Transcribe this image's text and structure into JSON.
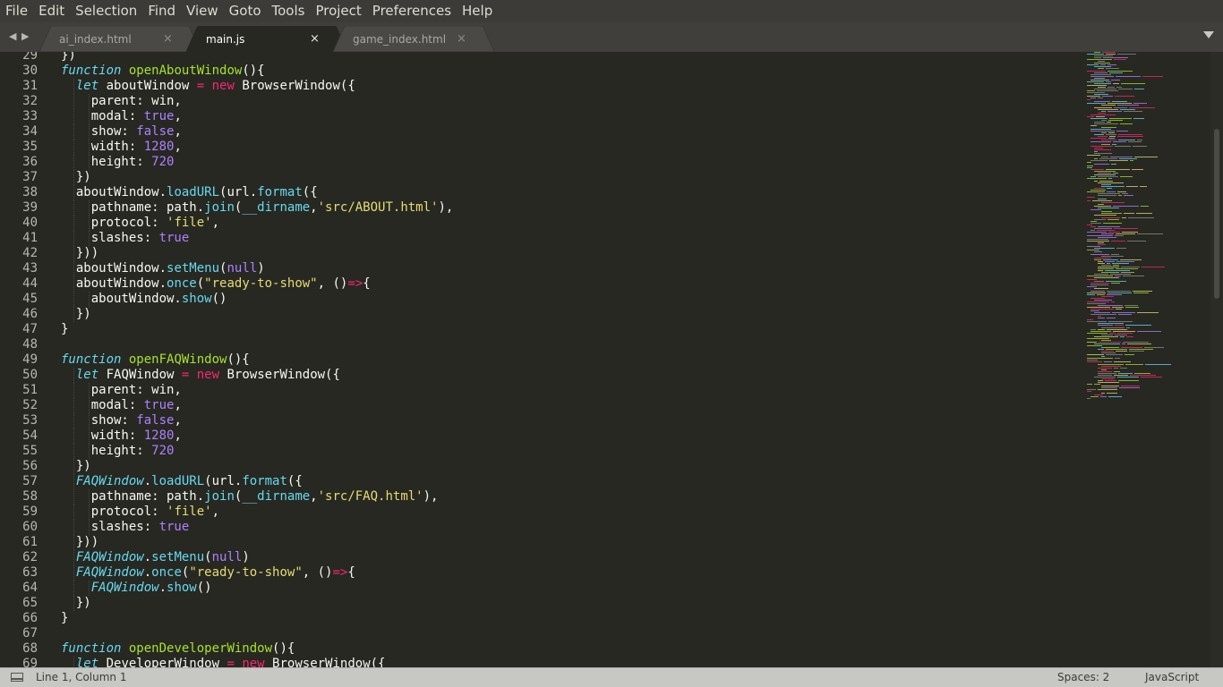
{
  "menu": [
    "File",
    "Edit",
    "Selection",
    "Find",
    "View",
    "Goto",
    "Tools",
    "Project",
    "Preferences",
    "Help"
  ],
  "tabs": [
    {
      "label": "ai_index.html",
      "active": false
    },
    {
      "label": "main.js",
      "active": true
    },
    {
      "label": "game_index.html",
      "active": false
    }
  ],
  "tab_close_glyph": "×",
  "nav": {
    "back_glyph": "◀",
    "forward_glyph": "▶"
  },
  "icons": [
    "back-arrow-icon",
    "forward-arrow-icon",
    "tab-close-icon",
    "tab-dropdown-icon",
    "panel-toggle-icon"
  ],
  "colors": {
    "background": "#272822",
    "keyword": "#f92672",
    "function_name": "#a6e22e",
    "builtin": "#66d9ef",
    "number": "#ae81ff",
    "string": "#e6db74",
    "text": "#f8f8f2",
    "gutter_text": "#b7b7af"
  },
  "editor": {
    "lines": [
      {
        "n": "29",
        "indent": 1,
        "tokens": [
          [
            "})",
            ""
          ]
        ]
      },
      {
        "n": "30",
        "indent": 1,
        "tokens": [
          [
            "function",
            "fi"
          ],
          [
            " ",
            ""
          ],
          [
            "openAboutWindow",
            "fn"
          ],
          [
            "(){",
            ""
          ]
        ]
      },
      {
        "n": "31",
        "indent": 2,
        "tokens": [
          [
            "let",
            "fi"
          ],
          [
            " aboutWindow ",
            ""
          ],
          [
            "=",
            "k"
          ],
          [
            " ",
            ""
          ],
          [
            "new",
            "k"
          ],
          [
            " BrowserWindow({",
            ""
          ]
        ]
      },
      {
        "n": "32",
        "indent": 3,
        "tokens": [
          [
            "parent: win,",
            ""
          ]
        ]
      },
      {
        "n": "33",
        "indent": 3,
        "tokens": [
          [
            "modal: ",
            ""
          ],
          [
            "true",
            "n"
          ],
          [
            ",",
            ""
          ]
        ]
      },
      {
        "n": "34",
        "indent": 3,
        "tokens": [
          [
            "show: ",
            ""
          ],
          [
            "false",
            "n"
          ],
          [
            ",",
            ""
          ]
        ]
      },
      {
        "n": "35",
        "indent": 3,
        "tokens": [
          [
            "width: ",
            ""
          ],
          [
            "1280",
            "n"
          ],
          [
            ",",
            ""
          ]
        ]
      },
      {
        "n": "36",
        "indent": 3,
        "tokens": [
          [
            "height: ",
            ""
          ],
          [
            "720",
            "n"
          ]
        ]
      },
      {
        "n": "37",
        "indent": 2,
        "tokens": [
          [
            "})",
            ""
          ]
        ]
      },
      {
        "n": "38",
        "indent": 2,
        "tokens": [
          [
            "aboutWindow.",
            ""
          ],
          [
            "loadURL",
            "m"
          ],
          [
            "(url.",
            ""
          ],
          [
            "format",
            "m"
          ],
          [
            "({",
            ""
          ]
        ]
      },
      {
        "n": "39",
        "indent": 3,
        "tokens": [
          [
            "pathname: path.",
            ""
          ],
          [
            "join",
            "m"
          ],
          [
            "(",
            ""
          ],
          [
            "__dirname",
            "m"
          ],
          [
            ",",
            ""
          ],
          [
            "'src/ABOUT.html'",
            "s"
          ],
          [
            "),",
            ""
          ]
        ]
      },
      {
        "n": "40",
        "indent": 3,
        "tokens": [
          [
            "protocol: ",
            ""
          ],
          [
            "'file'",
            "s"
          ],
          [
            ",",
            ""
          ]
        ]
      },
      {
        "n": "41",
        "indent": 3,
        "tokens": [
          [
            "slashes: ",
            ""
          ],
          [
            "true",
            "n"
          ]
        ]
      },
      {
        "n": "42",
        "indent": 2,
        "tokens": [
          [
            "}))",
            ""
          ]
        ]
      },
      {
        "n": "43",
        "indent": 2,
        "tokens": [
          [
            "aboutWindow.",
            ""
          ],
          [
            "setMenu",
            "m"
          ],
          [
            "(",
            ""
          ],
          [
            "null",
            "n"
          ],
          [
            ")",
            ""
          ]
        ]
      },
      {
        "n": "44",
        "indent": 2,
        "tokens": [
          [
            "aboutWindow.",
            ""
          ],
          [
            "once",
            "m"
          ],
          [
            "(",
            ""
          ],
          [
            "\"ready-to-show\"",
            "s"
          ],
          [
            ", ()",
            ""
          ],
          [
            "=>",
            "k"
          ],
          [
            "{",
            ""
          ]
        ]
      },
      {
        "n": "45",
        "indent": 3,
        "tokens": [
          [
            "aboutWindow.",
            ""
          ],
          [
            "show",
            "m"
          ],
          [
            "()",
            ""
          ]
        ]
      },
      {
        "n": "46",
        "indent": 2,
        "tokens": [
          [
            "})",
            ""
          ]
        ]
      },
      {
        "n": "47",
        "indent": 1,
        "tokens": [
          [
            "}",
            ""
          ]
        ]
      },
      {
        "n": "48",
        "indent": 0,
        "tokens": []
      },
      {
        "n": "49",
        "indent": 1,
        "tokens": [
          [
            "function",
            "fi"
          ],
          [
            " ",
            ""
          ],
          [
            "openFAQWindow",
            "fn"
          ],
          [
            "(){",
            ""
          ]
        ]
      },
      {
        "n": "50",
        "indent": 2,
        "tokens": [
          [
            "let",
            "fi"
          ],
          [
            " FAQWindow ",
            ""
          ],
          [
            "=",
            "k"
          ],
          [
            " ",
            ""
          ],
          [
            "new",
            "k"
          ],
          [
            " BrowserWindow({",
            ""
          ]
        ]
      },
      {
        "n": "51",
        "indent": 3,
        "tokens": [
          [
            "parent: win,",
            ""
          ]
        ]
      },
      {
        "n": "52",
        "indent": 3,
        "tokens": [
          [
            "modal: ",
            ""
          ],
          [
            "true",
            "n"
          ],
          [
            ",",
            ""
          ]
        ]
      },
      {
        "n": "53",
        "indent": 3,
        "tokens": [
          [
            "show: ",
            ""
          ],
          [
            "false",
            "n"
          ],
          [
            ",",
            ""
          ]
        ]
      },
      {
        "n": "54",
        "indent": 3,
        "tokens": [
          [
            "width: ",
            ""
          ],
          [
            "1280",
            "n"
          ],
          [
            ",",
            ""
          ]
        ]
      },
      {
        "n": "55",
        "indent": 3,
        "tokens": [
          [
            "height: ",
            ""
          ],
          [
            "720",
            "n"
          ]
        ]
      },
      {
        "n": "56",
        "indent": 2,
        "tokens": [
          [
            "})",
            ""
          ]
        ]
      },
      {
        "n": "57",
        "indent": 2,
        "tokens": [
          [
            "FAQWindow",
            "itc"
          ],
          [
            ".",
            ""
          ],
          [
            "loadURL",
            "m"
          ],
          [
            "(url.",
            ""
          ],
          [
            "format",
            "m"
          ],
          [
            "({",
            ""
          ]
        ]
      },
      {
        "n": "58",
        "indent": 3,
        "tokens": [
          [
            "pathname: path.",
            ""
          ],
          [
            "join",
            "m"
          ],
          [
            "(",
            ""
          ],
          [
            "__dirname",
            "m"
          ],
          [
            ",",
            ""
          ],
          [
            "'src/FAQ.html'",
            "s"
          ],
          [
            "),",
            ""
          ]
        ]
      },
      {
        "n": "59",
        "indent": 3,
        "tokens": [
          [
            "protocol: ",
            ""
          ],
          [
            "'file'",
            "s"
          ],
          [
            ",",
            ""
          ]
        ]
      },
      {
        "n": "60",
        "indent": 3,
        "tokens": [
          [
            "slashes: ",
            ""
          ],
          [
            "true",
            "n"
          ]
        ]
      },
      {
        "n": "61",
        "indent": 2,
        "tokens": [
          [
            "}))",
            ""
          ]
        ]
      },
      {
        "n": "62",
        "indent": 2,
        "tokens": [
          [
            "FAQWindow",
            "itc"
          ],
          [
            ".",
            ""
          ],
          [
            "setMenu",
            "m"
          ],
          [
            "(",
            ""
          ],
          [
            "null",
            "n"
          ],
          [
            ")",
            ""
          ]
        ]
      },
      {
        "n": "63",
        "indent": 2,
        "tokens": [
          [
            "FAQWindow",
            "itc"
          ],
          [
            ".",
            ""
          ],
          [
            "once",
            "m"
          ],
          [
            "(",
            ""
          ],
          [
            "\"ready-to-show\"",
            "s"
          ],
          [
            ", ()",
            ""
          ],
          [
            "=>",
            "k"
          ],
          [
            "{",
            ""
          ]
        ]
      },
      {
        "n": "64",
        "indent": 3,
        "tokens": [
          [
            "FAQWindow",
            "itc"
          ],
          [
            ".",
            ""
          ],
          [
            "show",
            "m"
          ],
          [
            "()",
            ""
          ]
        ]
      },
      {
        "n": "65",
        "indent": 2,
        "tokens": [
          [
            "})",
            ""
          ]
        ]
      },
      {
        "n": "66",
        "indent": 1,
        "tokens": [
          [
            "}",
            ""
          ]
        ]
      },
      {
        "n": "67",
        "indent": 0,
        "tokens": []
      },
      {
        "n": "68",
        "indent": 1,
        "tokens": [
          [
            "function",
            "fi"
          ],
          [
            " ",
            ""
          ],
          [
            "openDeveloperWindow",
            "fn"
          ],
          [
            "(){",
            ""
          ]
        ]
      },
      {
        "n": "69",
        "indent": 2,
        "tokens": [
          [
            "let",
            "fi"
          ],
          [
            " DeveloperWindow ",
            ""
          ],
          [
            "=",
            "k"
          ],
          [
            " ",
            ""
          ],
          [
            "new",
            "k"
          ],
          [
            " BrowserWindow({",
            ""
          ]
        ]
      }
    ]
  },
  "status": {
    "position": "Line 1, Column 1",
    "indentation": "Spaces: 2",
    "syntax": "JavaScript"
  }
}
